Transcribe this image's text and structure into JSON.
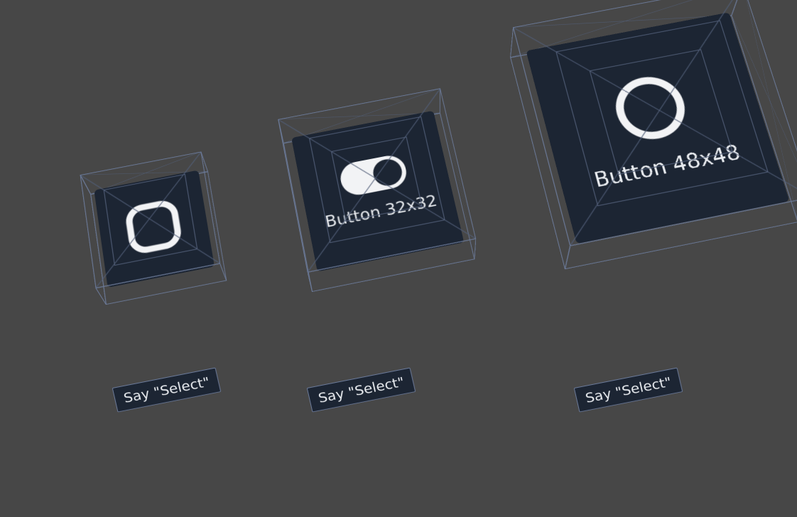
{
  "colors": {
    "background": "#474747",
    "tile": "#1c2533",
    "wire": "#6b7a99",
    "wire_inner": "#515e78",
    "icon": "#f2f3f5",
    "text": "#e8ebef"
  },
  "items": [
    {
      "id": "button-24",
      "label": "",
      "tooltip": "Say \"Select\"",
      "icon": "rounded-square-icon",
      "cube_size": 180
    },
    {
      "id": "button-32",
      "label": "Button 32x32",
      "tooltip": "Say \"Select\"",
      "icon": "toggle-icon",
      "cube_size": 240
    },
    {
      "id": "button-48",
      "label": "Button 48x48",
      "tooltip": "Say \"Select\"",
      "icon": "circle-icon",
      "cube_size": 340
    }
  ]
}
